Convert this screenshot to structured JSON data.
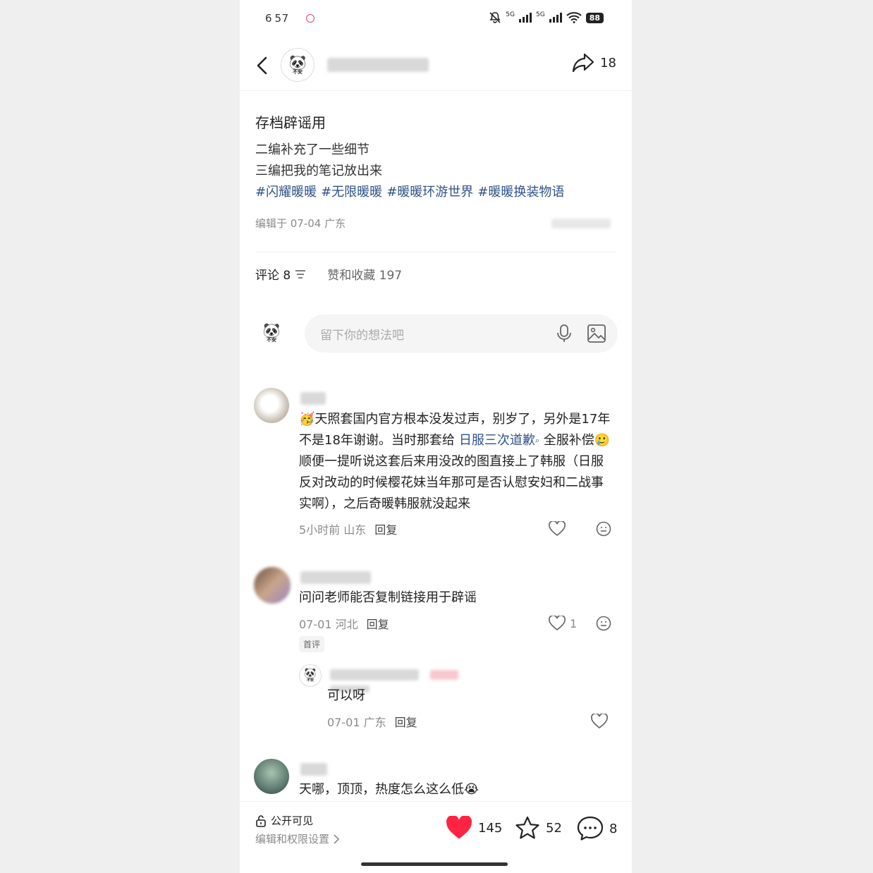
{
  "status": {
    "time": "6 57",
    "signal": "5G",
    "battery": "88"
  },
  "header": {
    "share_count": "18"
  },
  "post": {
    "title": "存档辟谣用",
    "lines": [
      "二编补充了一些细节",
      "三编把我的笔记放出来"
    ],
    "tags": [
      "#闪耀暖暖",
      "#无限暖暖",
      "#暖暖环游世界",
      "#暖暖换装物语"
    ],
    "meta": "编辑于 07-04 广东"
  },
  "tabs": {
    "comments": "评论 8",
    "likes": "赞和收藏 197"
  },
  "input": {
    "placeholder": "留下你的想法吧"
  },
  "comments": [
    {
      "text_a": "天照套国内官方根本没发过声，别岁了，另外是17年不是18年谢谢。当时那套给",
      "link": "日服三次道歉",
      "text_b": " 全服补偿",
      "text_c": "顺便一提听说这套后来用没改的图直接上了韩服（日服反对改动的时候樱花妹当年那可是否认慰安妇和二战事实啊），之后奇暖韩服就没起来",
      "meta": "5小时前 山东",
      "reply": "回复"
    },
    {
      "text": "问问老师能否复制链接用于辟谣",
      "meta": "07-01 河北",
      "reply": "回复",
      "likes": "1",
      "badge": "首评",
      "sub_reply": {
        "text": "可以呀",
        "meta": "07-01 广东",
        "reply": "回复"
      }
    },
    {
      "text": "天哪，顶顶，热度怎么这么低"
    }
  ],
  "bottom": {
    "visibility": "公开可见",
    "settings": "编辑和权限设置",
    "likes": "145",
    "stars": "52",
    "comments": "8"
  },
  "colors": {
    "link": "#2f5288",
    "like": "#ff2442"
  }
}
